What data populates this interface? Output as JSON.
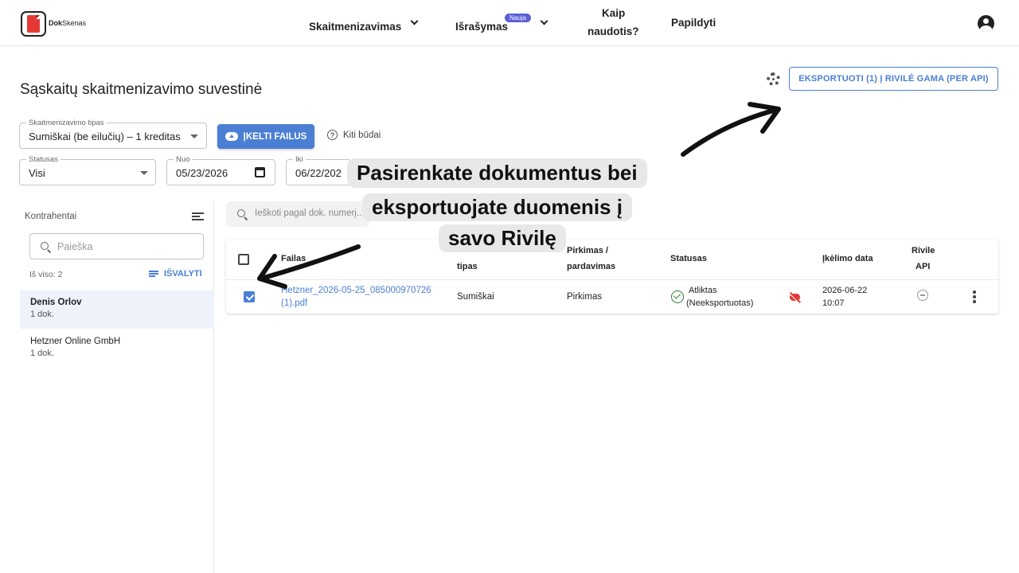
{
  "header": {
    "logo_text_bold": "Dok",
    "logo_text_light": "Skenas",
    "nav": {
      "digitization": "Skaitmenizavimas",
      "invoicing": "Išrašymas",
      "invoicing_badge": "Nauja",
      "howto_line1": "Kaip",
      "howto_line2": "naudotis?",
      "topup": "Papildyti"
    }
  },
  "page": {
    "title": "Sąskaitų skaitmenizavimo suvestinė",
    "export_button": "EKSPORTUOTI (1) Į RIVILĖ GAMA (PER API)"
  },
  "filters": {
    "digitization_type": {
      "label": "Skaitmenizavimo tipas",
      "value": "Sumiškai (be eilučių) – 1 kreditas"
    },
    "upload_button": "ĮKELTI FAILUS",
    "other_ways": "Kiti būdai",
    "status": {
      "label": "Statusas",
      "value": "Visi"
    },
    "from": {
      "label": "Nuo",
      "value": "05/23/2026"
    },
    "to": {
      "label": "Iki",
      "value": "06/22/202"
    }
  },
  "sidebar": {
    "title": "Kontrahentai",
    "search_placeholder": "Paieška",
    "total": "Iš viso: 2",
    "clear_button": "IŠVALYTI",
    "items": [
      {
        "name": "Denis Orlov",
        "count": "1 dok."
      },
      {
        "name": "Hetzner Online GmbH",
        "count": "1 dok."
      }
    ]
  },
  "main": {
    "search_placeholder": "Ieškoti pagal dok. numerį..."
  },
  "table": {
    "headers": {
      "file": "Failas",
      "type": "tipas",
      "purchase_sale_1": "Pirkimas /",
      "purchase_sale_2": "pardavimas",
      "status": "Statusas",
      "upload_date": "Įkėlimo data",
      "rivile_1": "Rivile",
      "rivile_2": "API"
    },
    "rows": [
      {
        "checked": true,
        "file_line1": "Hetzner_2026-05-25_085000970726",
        "file_line2": "(1).pdf",
        "type": "Sumiškai",
        "purchase_sale": "Pirkimas",
        "status_line1": "Atliktas",
        "status_line2": "(Neeksportuotas)",
        "date_line1": "2026-06-22",
        "date_line2": "10:07"
      }
    ]
  },
  "overlay": {
    "caption_line1": "Pasirenkate dokumentus bei",
    "caption_line2": "eksportuojate duomenis į",
    "caption_line3": "savo Rivilę"
  },
  "colors": {
    "accent": "#4a7fd4",
    "badge": "#5b5fd6",
    "success": "#2e7d32",
    "error": "#e53935"
  }
}
